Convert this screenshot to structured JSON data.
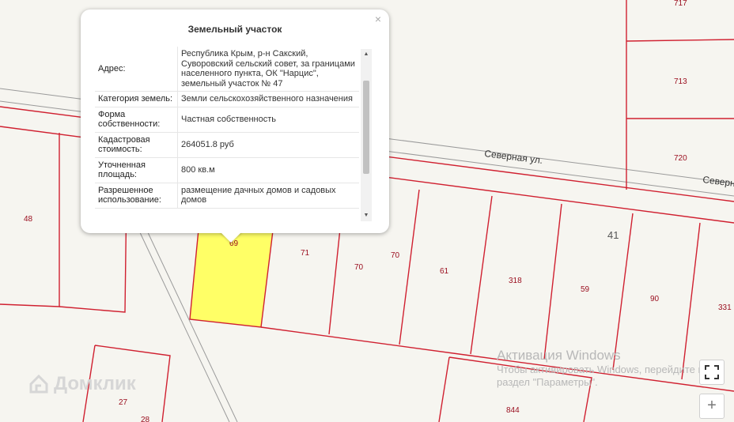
{
  "popup": {
    "title": "Земельный участок",
    "close_symbol": "×",
    "rows": [
      {
        "key": "Адрес:",
        "value": "Республика Крым, р-н Сакский, Суворовский сельский совет, за границами населенного пункта, ОК \"Нарцис\", земельный участок № 47"
      },
      {
        "key": "Категория земель:",
        "value": "Земли сельскохозяйственного назначения"
      },
      {
        "key": "Форма собственности:",
        "value": "Частная собственность"
      },
      {
        "key": "Кадастровая стоимость:",
        "value": "264051.8 руб"
      },
      {
        "key": "Уточненная площадь:",
        "value": "800 кв.м"
      },
      {
        "key": "Разрешенное использование:",
        "value": "размещение дачных домов и садовых домов"
      }
    ],
    "scroll_up": "▲",
    "scroll_down": "▼"
  },
  "map": {
    "roads": [
      "Северная ул.",
      "Северн"
    ],
    "quarter_label": "41",
    "plots": [
      "69",
      "71",
      "70",
      "70",
      "61",
      "318",
      "59",
      "90",
      "331",
      "48",
      "27",
      "28",
      "844",
      "713",
      "720",
      "717"
    ]
  },
  "watermark": {
    "title": "Активация Windows",
    "line1": "Чтобы активировать Windows, перейдите в",
    "line2": "раздел \"Параметры\"."
  },
  "logo": {
    "text": "Домклик"
  },
  "controls": {
    "zoom_in": "+"
  }
}
